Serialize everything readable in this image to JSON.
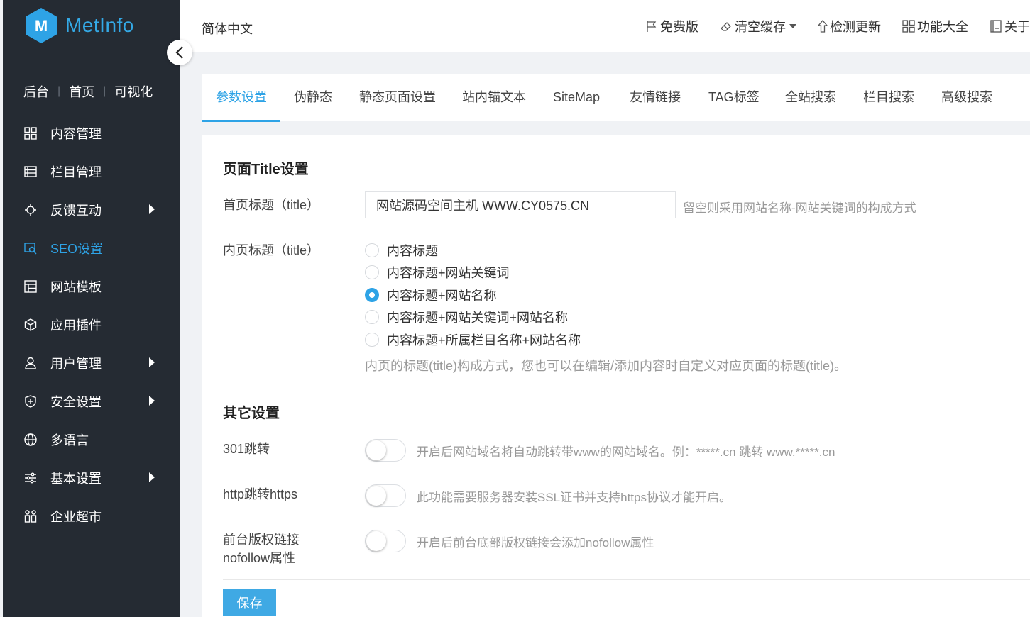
{
  "brand": {
    "name": "MetInfo",
    "color": "#2ea3e6"
  },
  "sidebar": {
    "top_links": [
      "后台",
      "首页",
      "可视化"
    ],
    "items": [
      {
        "label": "内容管理",
        "icon": "grid-icon",
        "arrow": false
      },
      {
        "label": "栏目管理",
        "icon": "list-icon",
        "arrow": false
      },
      {
        "label": "反馈互动",
        "icon": "feedback-icon",
        "arrow": true
      },
      {
        "label": "SEO设置",
        "icon": "seo-icon",
        "arrow": false,
        "active": true
      },
      {
        "label": "网站模板",
        "icon": "template-icon",
        "arrow": false
      },
      {
        "label": "应用插件",
        "icon": "cube-icon",
        "arrow": false
      },
      {
        "label": "用户管理",
        "icon": "user-icon",
        "arrow": true
      },
      {
        "label": "安全设置",
        "icon": "shield-icon",
        "arrow": true
      },
      {
        "label": "多语言",
        "icon": "globe-icon",
        "arrow": false
      },
      {
        "label": "基本设置",
        "icon": "sliders-icon",
        "arrow": true
      },
      {
        "label": "企业超市",
        "icon": "market-icon",
        "arrow": false
      }
    ]
  },
  "header": {
    "language": "简体中文",
    "links": [
      {
        "label": "免费版",
        "icon": "flag-icon"
      },
      {
        "label": "清空缓存",
        "icon": "eraser-icon",
        "dropdown": true
      },
      {
        "label": "检测更新",
        "icon": "arrow-up-icon"
      },
      {
        "label": "功能大全",
        "icon": "apps-icon"
      },
      {
        "label": "关于",
        "icon": "book-icon"
      }
    ]
  },
  "tabs": [
    "参数设置",
    "伪静态",
    "静态页面设置",
    "站内锚文本",
    "SiteMap",
    "友情链接",
    "TAG标签",
    "全站搜索",
    "栏目搜索",
    "高级搜索"
  ],
  "active_tab": "参数设置",
  "title_section": {
    "heading": "页面Title设置",
    "home_title_label": "首页标题（title）",
    "home_title_value": "网站源码空间主机 WWW.CY0575.CN",
    "home_title_hint": "留空则采用网站名称-网站关键词的构成方式",
    "inner_title_label": "内页标题（title）",
    "inner_title_options": [
      "内容标题",
      "内容标题+网站关键词",
      "内容标题+网站名称",
      "内容标题+网站关键词+网站名称",
      "内容标题+所属栏目名称+网站名称"
    ],
    "inner_title_selected": 2,
    "inner_title_hint": "内页的标题(title)构成方式，您也可以在编辑/添加内容时自定义对应页面的标题(title)。"
  },
  "other_section": {
    "heading": "其它设置",
    "redirect_301_label": "301跳转",
    "redirect_301_hint": "开启后网站域名将自动跳转带www的网站域名。例：*****.cn 跳转 www.*****.cn",
    "https_label": "http跳转https",
    "https_hint": "此功能需要服务器安装SSL证书并支持https协议才能开启。",
    "nofollow_label_line1": "前台版权链接",
    "nofollow_label_line2": "nofollow属性",
    "nofollow_hint": "开启后前台底部版权链接会添加nofollow属性"
  },
  "save_label": "保存"
}
